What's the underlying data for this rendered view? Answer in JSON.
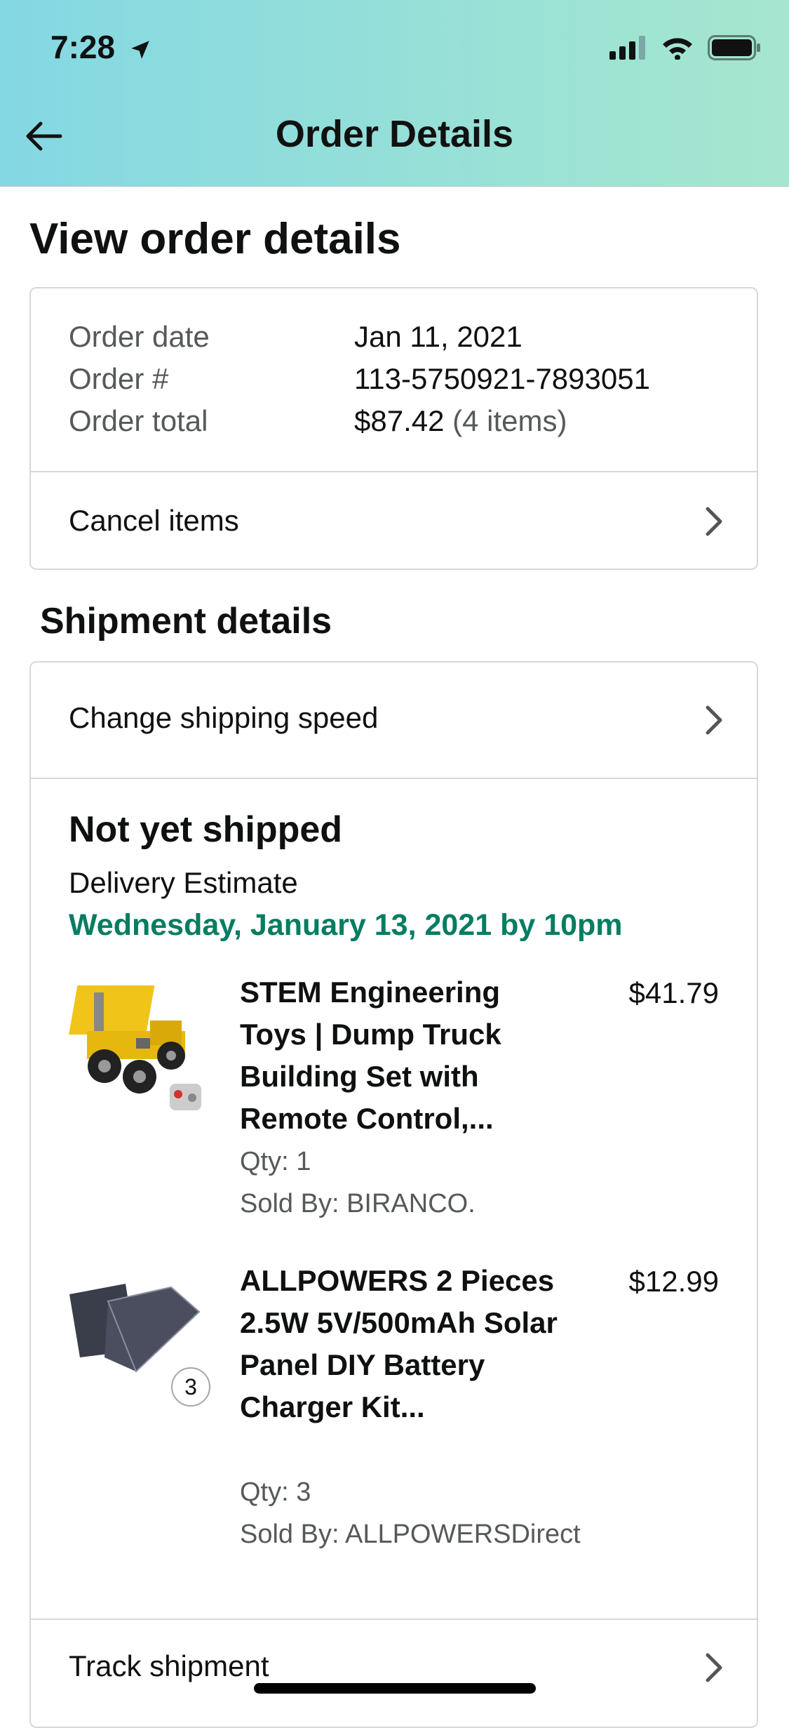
{
  "status_bar": {
    "time": "7:28"
  },
  "header": {
    "title": "Order Details"
  },
  "page_title": "View order details",
  "summary": {
    "rows": [
      {
        "label": "Order date",
        "value": "Jan 11, 2021",
        "extra": ""
      },
      {
        "label": "Order #",
        "value": "113-5750921-7893051",
        "extra": ""
      },
      {
        "label": "Order total",
        "value": "$87.42",
        "extra": "(4 items)"
      }
    ],
    "cancel_label": "Cancel items"
  },
  "shipment": {
    "heading": "Shipment details",
    "change_speed_label": "Change shipping speed",
    "status": "Not yet shipped",
    "estimate_label": "Delivery Estimate",
    "estimate_date": "Wednesday, January 13, 2021 by 10pm",
    "colors": {
      "estimate": "#067d62"
    },
    "items": [
      {
        "title": "STEM Engineering Toys | Dump Truck Building Set with Remote Control,...",
        "price": "$41.79",
        "qty": "Qty: 1",
        "seller": "Sold By: BIRANCO.",
        "image_icon": "toy-truck-image"
      },
      {
        "title": "ALLPOWERS 2 Pieces 2.5W 5V/500mAh Solar Panel DIY Battery Charger Kit...",
        "price": "$12.99",
        "qty": "Qty: 3",
        "seller": "Sold By: ALLPOWERSDirect",
        "badge": "3",
        "image_icon": "solar-panel-image"
      }
    ],
    "track_label": "Track shipment"
  }
}
